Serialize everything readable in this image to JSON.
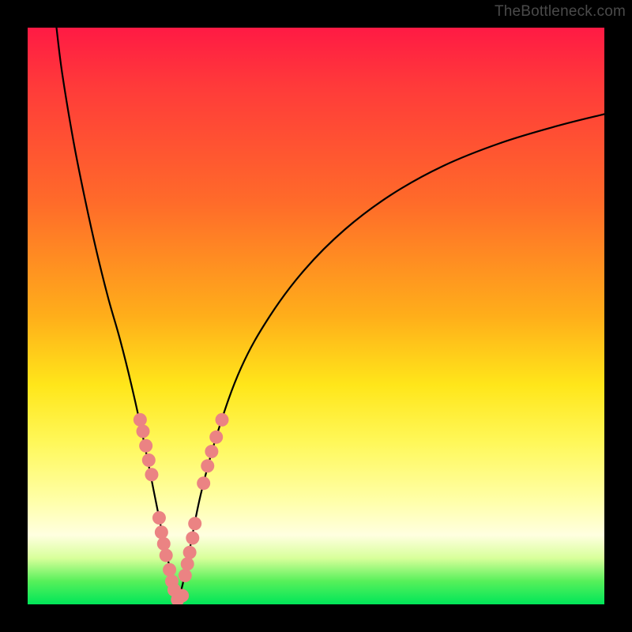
{
  "watermark": "TheBottleneck.com",
  "chart_data": {
    "type": "line",
    "title": "",
    "xlabel": "",
    "ylabel": "",
    "xlim": [
      0,
      100
    ],
    "ylim": [
      0,
      100
    ],
    "series": [
      {
        "name": "left-curve",
        "x": [
          5,
          6,
          8,
          10,
          12,
          14,
          16,
          18,
          20,
          22,
          23,
          24,
          25,
          25.5,
          26
        ],
        "y": [
          100,
          92,
          80,
          70,
          61,
          53,
          46,
          38,
          29,
          19,
          14,
          9,
          5,
          2,
          0
        ]
      },
      {
        "name": "right-curve",
        "x": [
          26,
          27,
          28,
          30,
          33,
          37,
          42,
          48,
          55,
          63,
          72,
          82,
          92,
          100
        ],
        "y": [
          0,
          4,
          9,
          19,
          30,
          41,
          50,
          58,
          65,
          71,
          76,
          80,
          83,
          85
        ]
      }
    ],
    "bead_clusters": [
      {
        "name": "left-upper-beads",
        "points": [
          {
            "x": 19.5,
            "y": 32
          },
          {
            "x": 20.0,
            "y": 30
          },
          {
            "x": 20.5,
            "y": 27.5
          },
          {
            "x": 21.0,
            "y": 25
          },
          {
            "x": 21.5,
            "y": 22.5
          }
        ]
      },
      {
        "name": "left-lower-beads",
        "points": [
          {
            "x": 22.8,
            "y": 15
          },
          {
            "x": 23.2,
            "y": 12.5
          },
          {
            "x": 23.6,
            "y": 10.5
          },
          {
            "x": 24.0,
            "y": 8.5
          },
          {
            "x": 24.6,
            "y": 6
          },
          {
            "x": 25.0,
            "y": 4
          },
          {
            "x": 25.4,
            "y": 2.5
          }
        ]
      },
      {
        "name": "bottom-beads",
        "points": [
          {
            "x": 26.0,
            "y": 0.8
          },
          {
            "x": 26.8,
            "y": 1.5
          }
        ]
      },
      {
        "name": "right-lower-beads",
        "points": [
          {
            "x": 27.3,
            "y": 5
          },
          {
            "x": 27.7,
            "y": 7
          },
          {
            "x": 28.1,
            "y": 9
          },
          {
            "x": 28.6,
            "y": 11.5
          },
          {
            "x": 29.0,
            "y": 14
          }
        ]
      },
      {
        "name": "right-upper-beads",
        "points": [
          {
            "x": 30.5,
            "y": 21
          },
          {
            "x": 31.2,
            "y": 24
          },
          {
            "x": 31.9,
            "y": 26.5
          },
          {
            "x": 32.7,
            "y": 29
          },
          {
            "x": 33.7,
            "y": 32
          }
        ]
      }
    ],
    "background_gradient": {
      "top": "#ff1a44",
      "bottom": "#00e659"
    }
  }
}
